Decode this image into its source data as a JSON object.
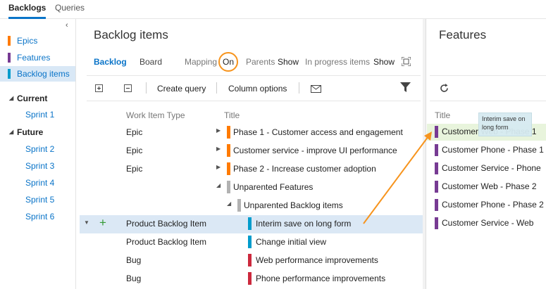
{
  "top_tabs": {
    "backlogs": "Backlogs",
    "queries": "Queries"
  },
  "left_nav": {
    "items": [
      {
        "label": "Epics",
        "color": "#ff7b00"
      },
      {
        "label": "Features",
        "color": "#773b93"
      },
      {
        "label": "Backlog items",
        "color": "#009ccc",
        "selected": true
      }
    ],
    "current_label": "Current",
    "current_sprints": [
      "Sprint 1"
    ],
    "future_label": "Future",
    "future_sprints": [
      "Sprint 2",
      "Sprint 3",
      "Sprint 4",
      "Sprint 5",
      "Sprint 6"
    ]
  },
  "main": {
    "title": "Backlog items",
    "tabs": {
      "backlog": "Backlog",
      "board": "Board"
    },
    "options": {
      "mapping_label": "Mapping",
      "mapping_value": "On",
      "parents_label": "Parents",
      "parents_value": "Show",
      "inprogress_label": "In progress items",
      "inprogress_value": "Show"
    },
    "toolbar": {
      "create_query": "Create query",
      "column_options": "Column options"
    },
    "columns": {
      "type": "Work Item Type",
      "title": "Title"
    },
    "rows": [
      {
        "type": "Epic",
        "title": "Phase 1 - Customer access and engagement",
        "color": "#ff7b00"
      },
      {
        "type": "Epic",
        "title": "Customer service - improve UI performance",
        "color": "#ff7b00"
      },
      {
        "type": "Epic",
        "title": "Phase 2 - Increase customer adoption",
        "color": "#ff7b00"
      },
      {
        "type": "",
        "title": "Unparented Features",
        "color": "#b2b2b2"
      },
      {
        "type": "",
        "title": "Unparented Backlog items",
        "color": "#b2b2b2"
      },
      {
        "type": "Product Backlog Item",
        "title": "Interim save on long form",
        "color": "#009ccc"
      },
      {
        "type": "Product Backlog Item",
        "title": "Change initial view",
        "color": "#009ccc"
      },
      {
        "type": "Bug",
        "title": "Web performance improvements",
        "color": "#cc293d"
      },
      {
        "type": "Bug",
        "title": "Phone performance improvements",
        "color": "#cc293d"
      }
    ]
  },
  "features": {
    "title": "Features",
    "column_title": "Title",
    "items": [
      "Customer Web - Phase 1",
      "Customer Phone - Phase 1",
      "Customer Service - Phone",
      "Customer Web - Phase 2",
      "Customer Phone - Phase 2",
      "Customer Service - Web"
    ],
    "drag_ghost": "Interim save on long form"
  },
  "colors": {
    "accent": "#0a74c8",
    "annotation": "#f7941d"
  }
}
